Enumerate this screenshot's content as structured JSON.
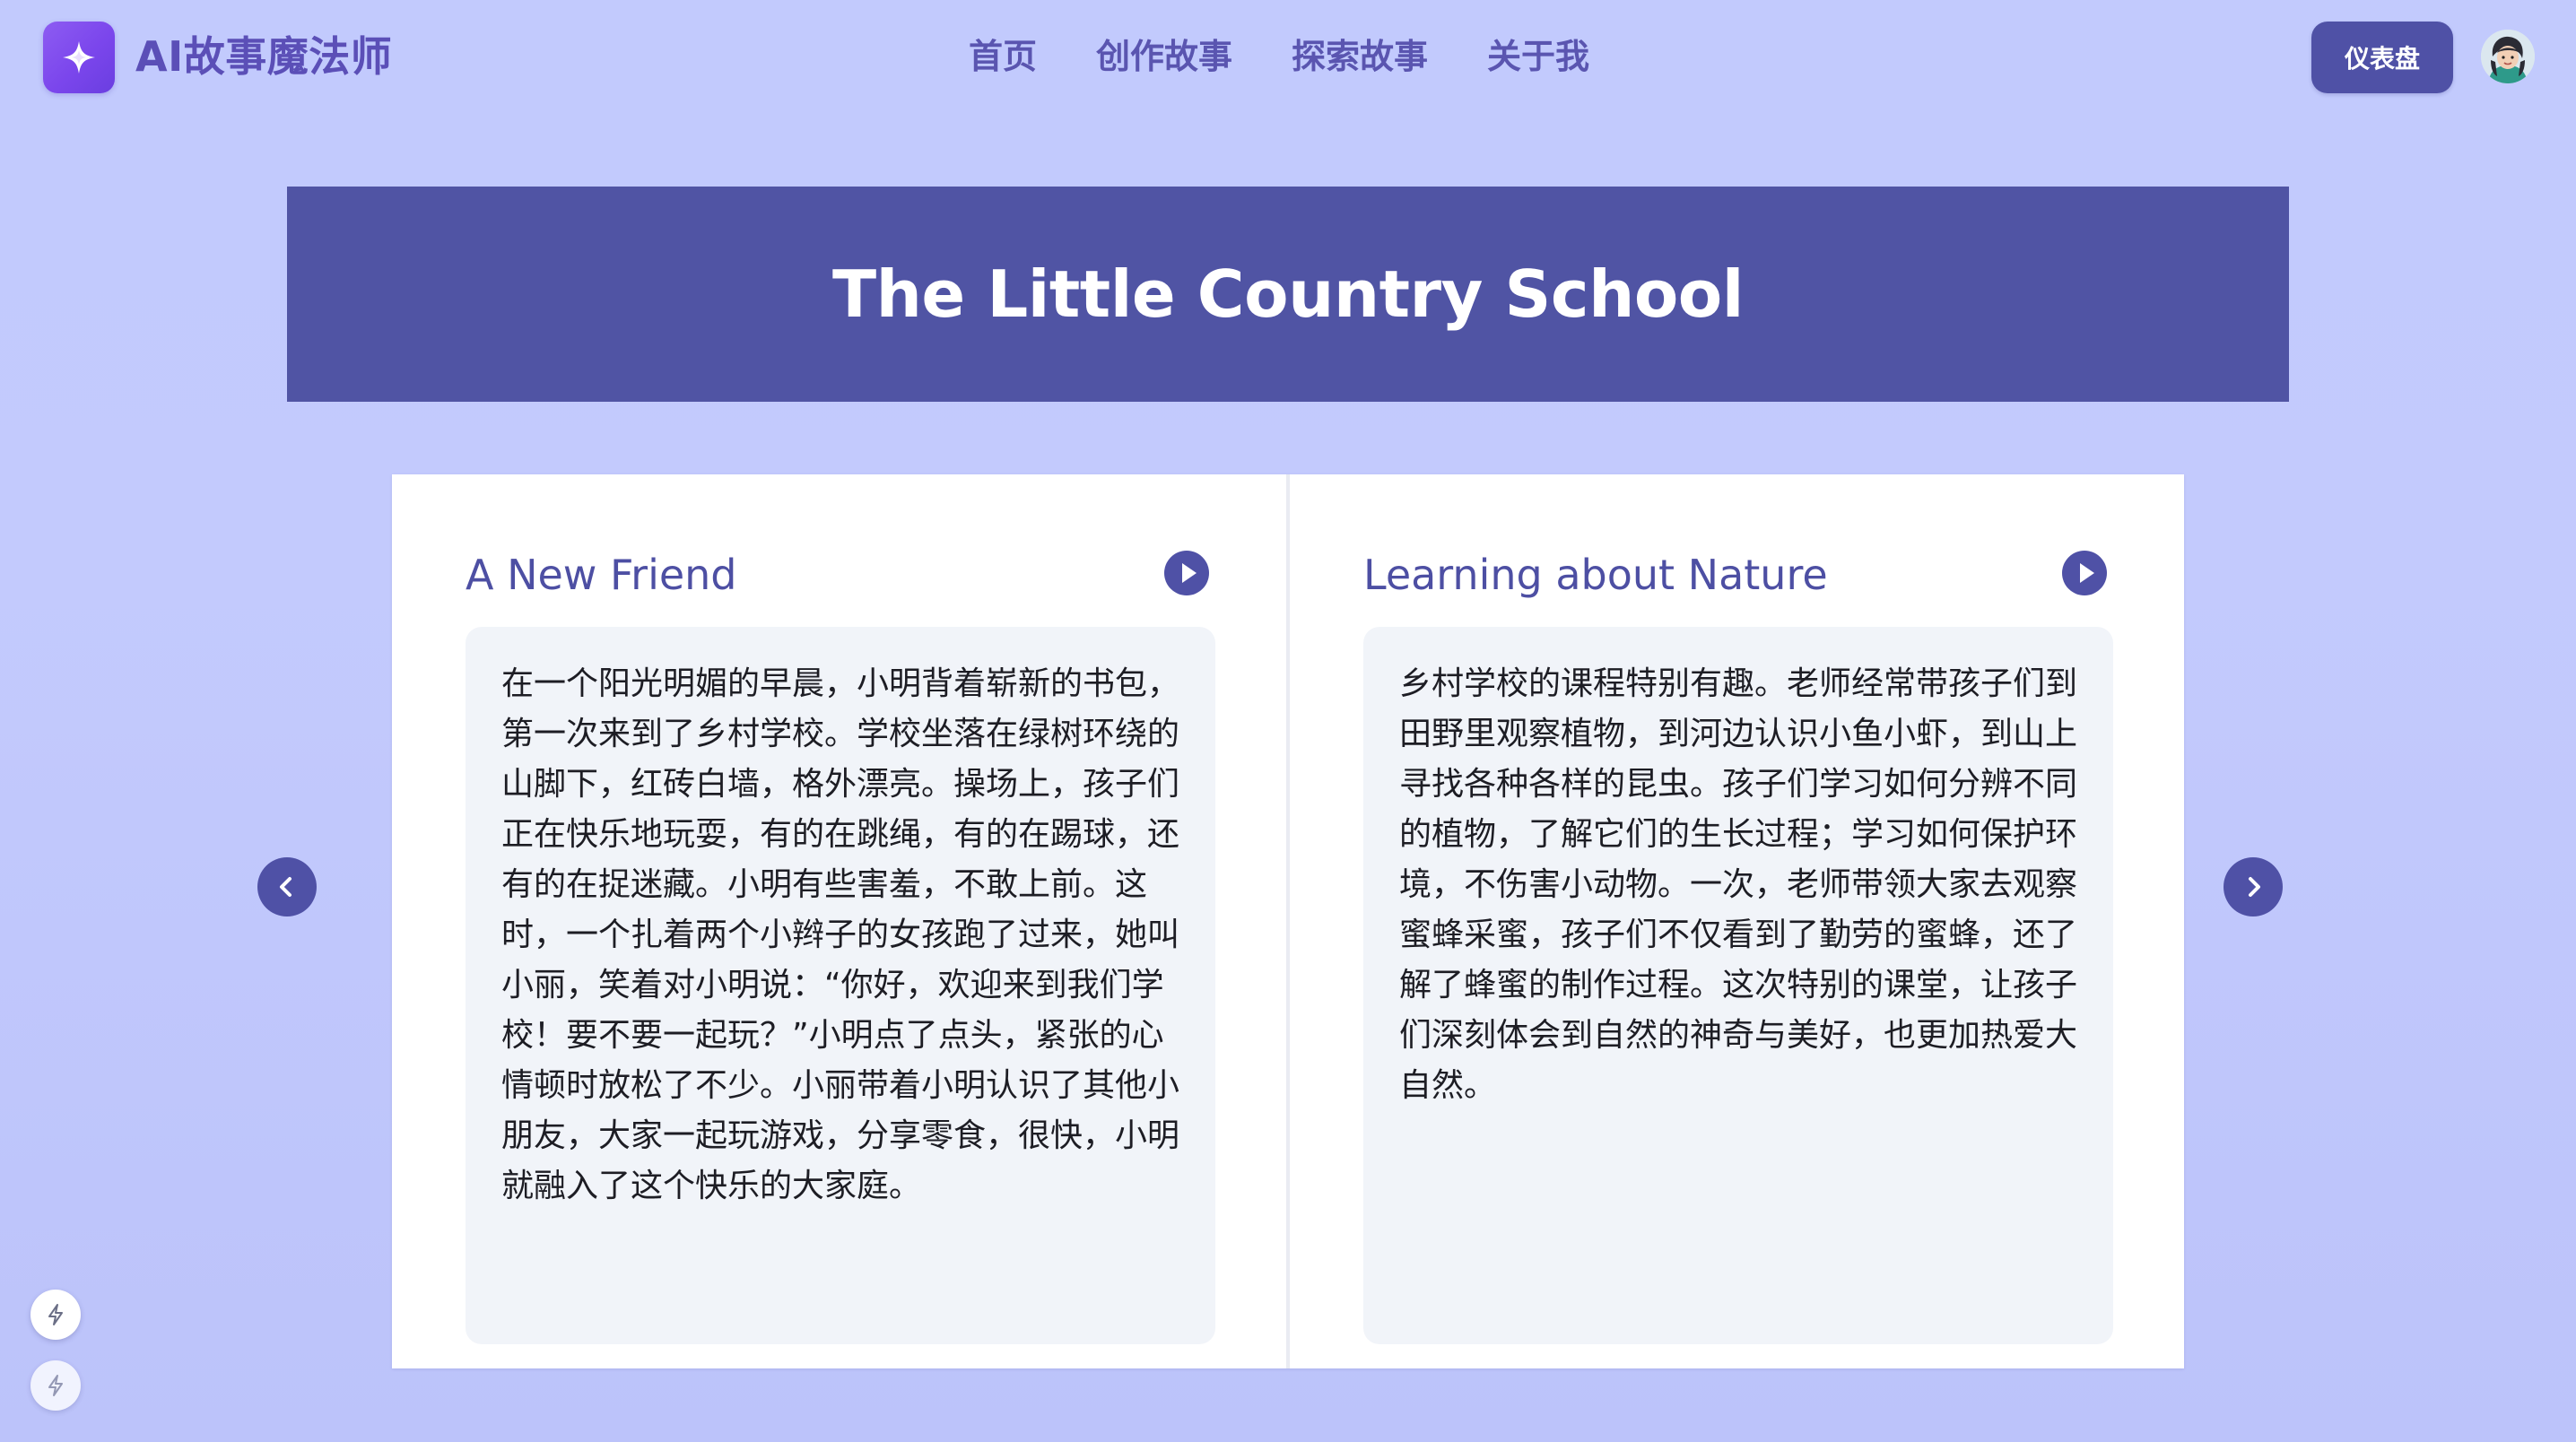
{
  "brand": {
    "name": "AI故事魔法师",
    "logo_icon": "sparkle-icon"
  },
  "nav": {
    "items": [
      {
        "label": "首页"
      },
      {
        "label": "创作故事"
      },
      {
        "label": "探索故事"
      },
      {
        "label": "关于我"
      }
    ]
  },
  "header": {
    "dashboard_label": "仪表盘",
    "avatar_icon": "user-avatar"
  },
  "story": {
    "title": "The Little Country School",
    "pages": [
      {
        "title": "A New Friend",
        "text": "在一个阳光明媚的早晨，小明背着崭新的书包，第一次来到了乡村学校。学校坐落在绿树环绕的山脚下，红砖白墙，格外漂亮。操场上，孩子们正在快乐地玩耍，有的在跳绳，有的在踢球，还有的在捉迷藏。小明有些害羞，不敢上前。这时，一个扎着两个小辫子的女孩跑了过来，她叫小丽，笑着对小明说：“你好，欢迎来到我们学校！要不要一起玩？”小明点了点头，紧张的心情顿时放松了不少。小丽带着小明认识了其他小朋友，大家一起玩游戏，分享零食，很快，小明就融入了这个快乐的大家庭。"
      },
      {
        "title": "Learning about Nature",
        "text": "乡村学校的课程特别有趣。老师经常带孩子们到田野里观察植物，到河边认识小鱼小虾，到山上寻找各种各样的昆虫。孩子们学习如何分辨不同的植物，了解它们的生长过程；学习如何保护环境，不伤害小动物。一次，老师带领大家去观察蜜蜂采蜜，孩子们不仅看到了勤劳的蜜蜂，还了解了蜂蜜的制作过程。这次特别的课堂，让孩子们深刻体会到自然的神奇与美好，也更加热爱大自然。"
      }
    ]
  },
  "controls": {
    "prev_icon": "chevron-left-icon",
    "next_icon": "chevron-right-icon",
    "play_icon": "play-icon",
    "floating_icon": "lightning-icon"
  },
  "colors": {
    "background": "#c2cafd",
    "accent": "#4f51a6",
    "brand_gradient_start": "#8d5cf2",
    "page_text_bg": "#f1f4f9"
  }
}
